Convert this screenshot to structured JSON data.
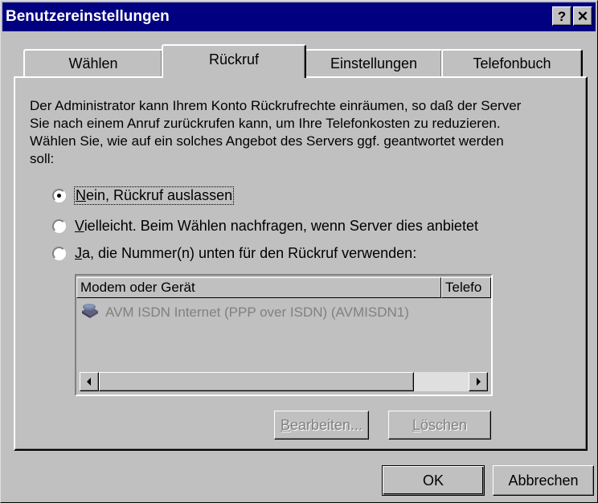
{
  "window": {
    "title": "Benutzereinstellungen",
    "help_label": "?",
    "close_label": "✕"
  },
  "tabs": [
    {
      "label": "Wählen",
      "active": false
    },
    {
      "label": "Rückruf",
      "active": true
    },
    {
      "label": "Einstellungen",
      "active": false
    },
    {
      "label": "Telefonbuch",
      "active": false
    }
  ],
  "description": "Der Administrator kann Ihrem Konto Rückrufrechte einräumen, so daß der Server Sie nach einem Anruf zurückrufen kann, um Ihre Telefonkosten zu reduzieren. Wählen Sie, wie auf ein solches Angebot des Servers ggf. geantwortet werden soll:",
  "options": [
    {
      "accel": "N",
      "rest": "ein, Rückruf auslassen",
      "selected": true
    },
    {
      "accel": "V",
      "rest": "ielleicht. Beim Wählen nachfragen, wenn Server dies anbietet",
      "selected": false
    },
    {
      "accel": "J",
      "rest": "a, die Nummer(n) unten für den Rückruf verwenden:",
      "selected": false
    }
  ],
  "callback_list": {
    "columns": [
      "Modem oder Gerät",
      "Telefo"
    ],
    "rows": [
      {
        "device": "AVM ISDN Internet (PPP over ISDN) (AVMISDN1)",
        "icon": "modem-icon"
      }
    ]
  },
  "buttons": {
    "edit": {
      "accel": "B",
      "rest": "earbeiten..."
    },
    "delete": {
      "accel": "L",
      "rest": "öschen"
    },
    "ok": {
      "label": "OK"
    },
    "cancel": {
      "label": "Abbrechen"
    }
  }
}
